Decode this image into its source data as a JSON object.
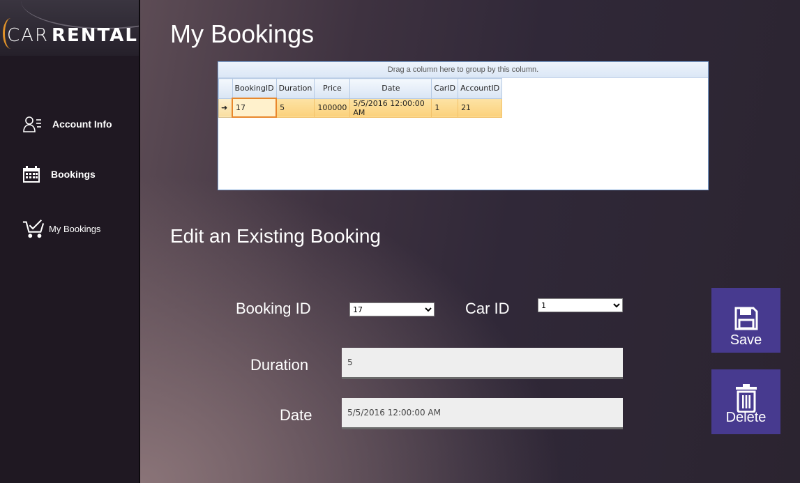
{
  "app": {
    "logo_car": "CAR",
    "logo_rental": "RENTAL"
  },
  "sidebar": {
    "items": [
      {
        "label": "Account Info",
        "icon": "account-info-icon"
      },
      {
        "label": "Bookings",
        "icon": "calendar-icon"
      },
      {
        "label": "My Bookings",
        "icon": "cart-check-icon"
      }
    ]
  },
  "page": {
    "title": "My Bookings"
  },
  "grid": {
    "group_hint": "Drag a column here to group by this column.",
    "columns": [
      "BookingID",
      "Duration",
      "Price",
      "Date",
      "CarID",
      "AccountID"
    ],
    "rows": [
      [
        "17",
        "5",
        "100000",
        "5/5/2016 12:00:00 AM",
        "1",
        "21"
      ]
    ]
  },
  "edit": {
    "title": "Edit an Existing Booking",
    "booking_id_label": "Booking ID",
    "booking_id_value": "17",
    "car_id_label": "Car ID",
    "car_id_value": "1",
    "duration_label": "Duration",
    "duration_value": "5",
    "date_label": "Date",
    "date_value": "5/5/2016 12:00:00 AM"
  },
  "actions": {
    "save_label": "Save",
    "delete_label": "Delete"
  },
  "colors": {
    "accent": "#473a8f",
    "sidebar_bg": "#1f1822",
    "row_highlight": "#fbd17c"
  }
}
